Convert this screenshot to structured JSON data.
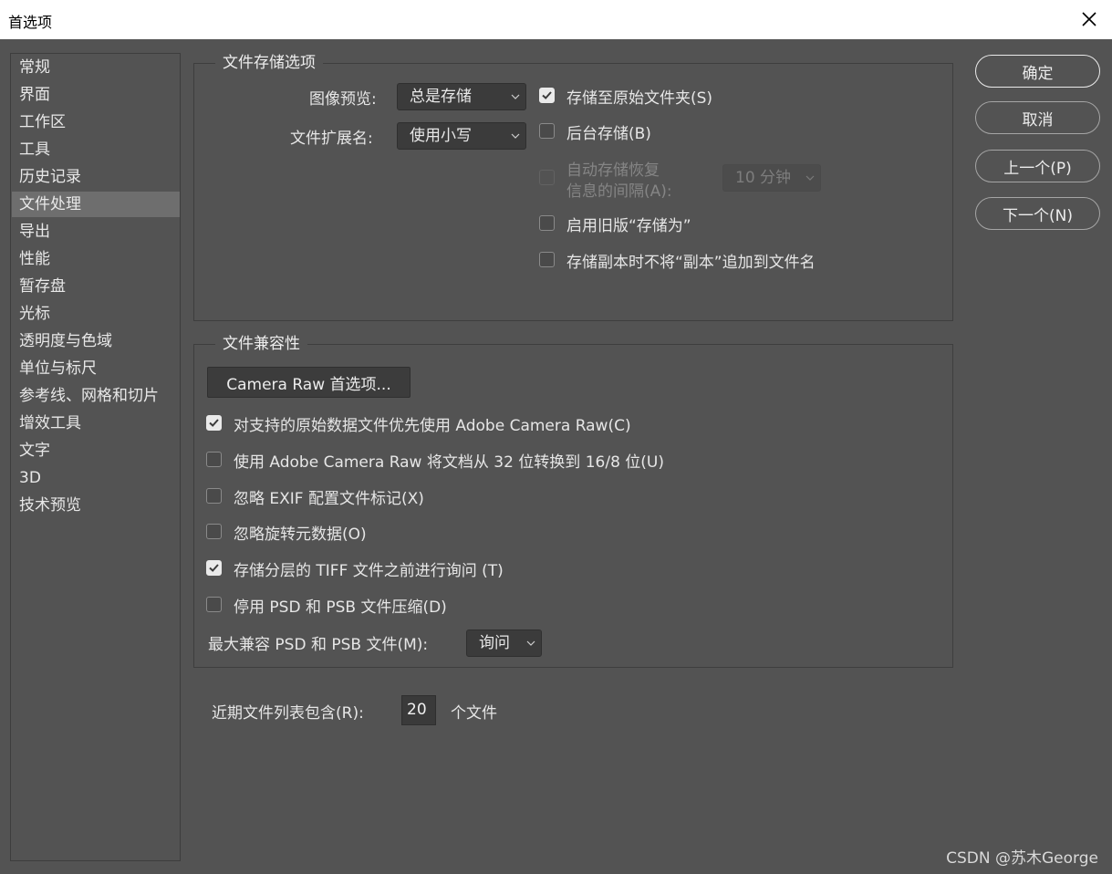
{
  "window": {
    "title": "首选项"
  },
  "sidebar": {
    "items": [
      {
        "label": "常规"
      },
      {
        "label": "界面"
      },
      {
        "label": "工作区"
      },
      {
        "label": "工具"
      },
      {
        "label": "历史记录"
      },
      {
        "label": "文件处理",
        "active": true
      },
      {
        "label": "导出"
      },
      {
        "label": "性能"
      },
      {
        "label": "暂存盘"
      },
      {
        "label": "光标"
      },
      {
        "label": "透明度与色域"
      },
      {
        "label": "单位与标尺"
      },
      {
        "label": "参考线、网格和切片"
      },
      {
        "label": "增效工具"
      },
      {
        "label": "文字"
      },
      {
        "label": "3D"
      },
      {
        "label": "技术预览"
      }
    ]
  },
  "save_options": {
    "title": "文件存储选项",
    "image_preview_label": "图像预览:",
    "image_preview_value": "总是存储",
    "extension_label": "文件扩展名:",
    "extension_value": "使用小写",
    "save_to_original_folder": {
      "label": "存储至原始文件夹(S)",
      "checked": true
    },
    "background_save": {
      "label": "后台存储(B)",
      "checked": false
    },
    "autosave_line1": "自动存储恢复",
    "autosave_line2": "信息的间隔(A):",
    "autosave_interval_value": "10 分钟",
    "legacy_save_as": {
      "label": "启用旧版“存储为”",
      "checked": false
    },
    "no_copy_suffix": {
      "label": "存储副本时不将“副本”追加到文件名",
      "checked": false
    }
  },
  "compatibility": {
    "title": "文件兼容性",
    "camera_raw_button": "Camera Raw 首选项...",
    "options": [
      {
        "label": "对支持的原始数据文件优先使用 Adobe Camera Raw(C)",
        "checked": true
      },
      {
        "label": "使用 Adobe Camera Raw 将文档从 32 位转换到 16/8 位(U)",
        "checked": false
      },
      {
        "label": "忽略 EXIF 配置文件标记(X)",
        "checked": false
      },
      {
        "label": "忽略旋转元数据(O)",
        "checked": false
      },
      {
        "label": "存储分层的 TIFF 文件之前进行询问 (T)",
        "checked": true
      },
      {
        "label": "停用 PSD 和 PSB 文件压缩(D)",
        "checked": false
      }
    ],
    "max_compat_label": "最大兼容 PSD 和 PSB 文件(M):",
    "max_compat_value": "询问"
  },
  "recent": {
    "label": "近期文件列表包含(R):",
    "value": "20",
    "suffix": "个文件"
  },
  "buttons": {
    "ok": "确定",
    "cancel": "取消",
    "prev": "上一个(P)",
    "next": "下一个(N)"
  },
  "watermark": "CSDN @苏木George"
}
